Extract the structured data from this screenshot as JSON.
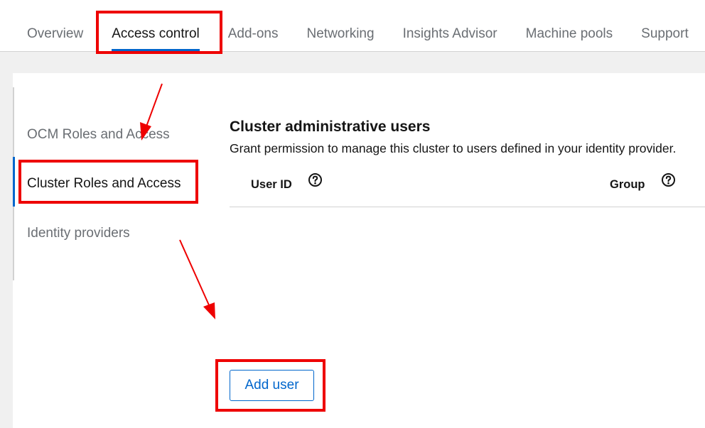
{
  "tabs": [
    {
      "label": "Overview"
    },
    {
      "label": "Access control"
    },
    {
      "label": "Add-ons"
    },
    {
      "label": "Networking"
    },
    {
      "label": "Insights Advisor"
    },
    {
      "label": "Machine pools"
    },
    {
      "label": "Support"
    }
  ],
  "active_tab": "Access control",
  "sidenav": {
    "items": [
      {
        "label": "OCM Roles and Access"
      },
      {
        "label": "Cluster Roles and Access"
      },
      {
        "label": "Identity providers"
      }
    ],
    "active": "Cluster Roles and Access"
  },
  "section": {
    "title": "Cluster administrative users",
    "description": "Grant permission to manage this cluster to users defined in your identity provider."
  },
  "table": {
    "columns": [
      {
        "label": "User ID",
        "icon": "help-circle-icon"
      },
      {
        "label": "Group",
        "icon": "help-circle-icon"
      }
    ]
  },
  "add_user_label": "Add user",
  "colors": {
    "accent": "#0066cc",
    "annotation": "#ee0000"
  }
}
